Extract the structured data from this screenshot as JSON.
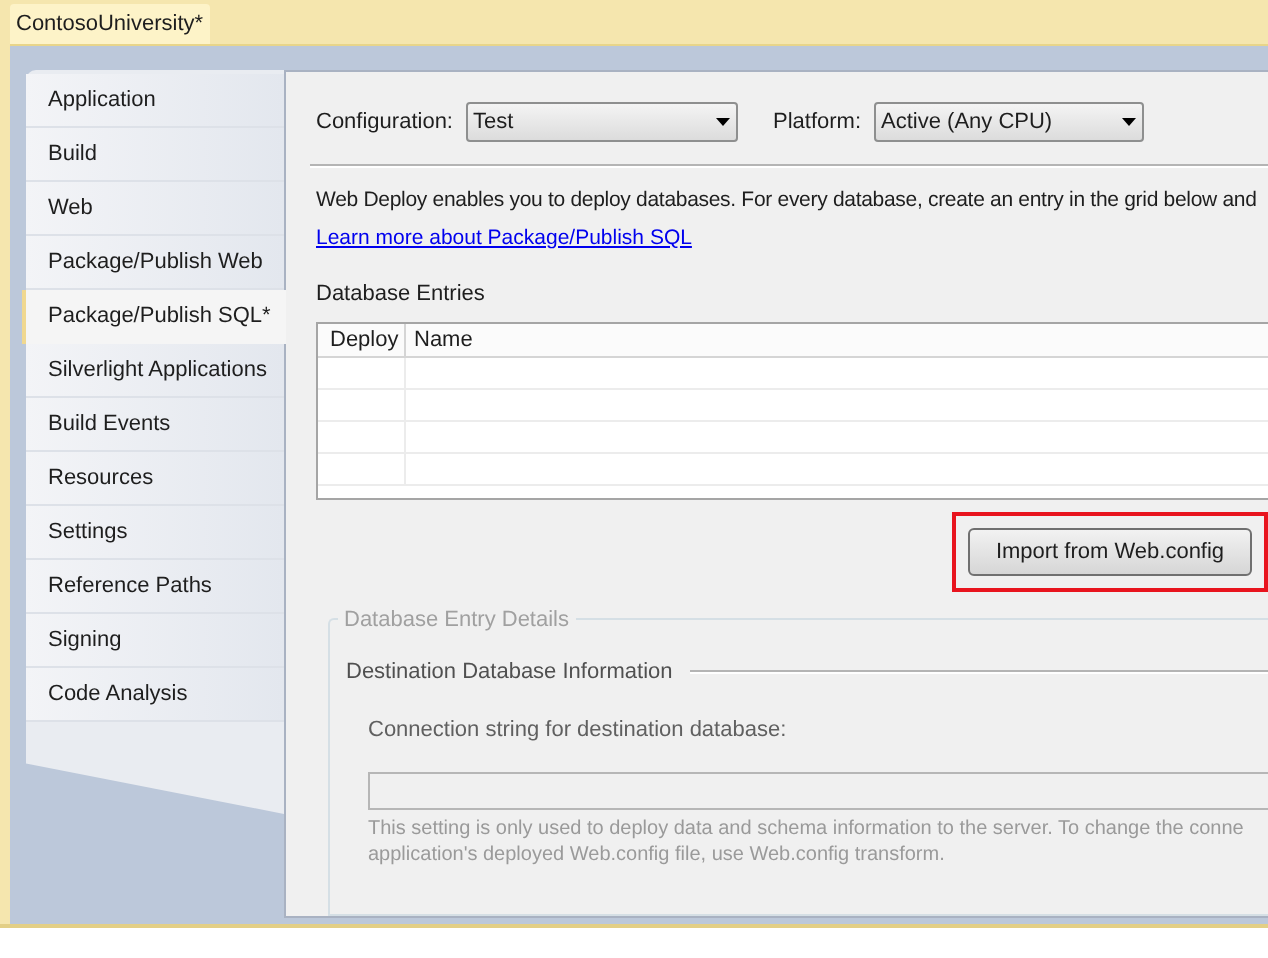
{
  "window": {
    "title": "ContosoUniversity*"
  },
  "sidebar": {
    "items": [
      {
        "label": "Application",
        "selected": false
      },
      {
        "label": "Build",
        "selected": false
      },
      {
        "label": "Web",
        "selected": false
      },
      {
        "label": "Package/Publish Web",
        "selected": false
      },
      {
        "label": "Package/Publish SQL*",
        "selected": true
      },
      {
        "label": "Silverlight Applications",
        "selected": false
      },
      {
        "label": "Build Events",
        "selected": false
      },
      {
        "label": "Resources",
        "selected": false
      },
      {
        "label": "Settings",
        "selected": false
      },
      {
        "label": "Reference Paths",
        "selected": false
      },
      {
        "label": "Signing",
        "selected": false
      },
      {
        "label": "Code Analysis",
        "selected": false
      }
    ]
  },
  "toolbar": {
    "configuration": {
      "label": "Configuration:",
      "value": "Test"
    },
    "platform": {
      "label": "Platform:",
      "value": "Active (Any CPU)"
    }
  },
  "description": "Web Deploy enables you to deploy databases. For every database, create an entry in the grid below and",
  "link": "Learn more about Package/Publish SQL",
  "database_entries": {
    "title": "Database Entries",
    "columns": [
      "Deploy",
      "Name"
    ]
  },
  "import_button": {
    "label": "Import from Web.config",
    "highlighted": true
  },
  "details": {
    "title": "Database Entry Details",
    "disabled": true,
    "section": "Destination Database Information",
    "field_label": "Connection string for destination database:",
    "hint_lines": [
      "This setting is only used to deploy data and schema information to the server. To change the conne",
      "application's deployed Web.config file, use Web.config transform."
    ]
  }
}
